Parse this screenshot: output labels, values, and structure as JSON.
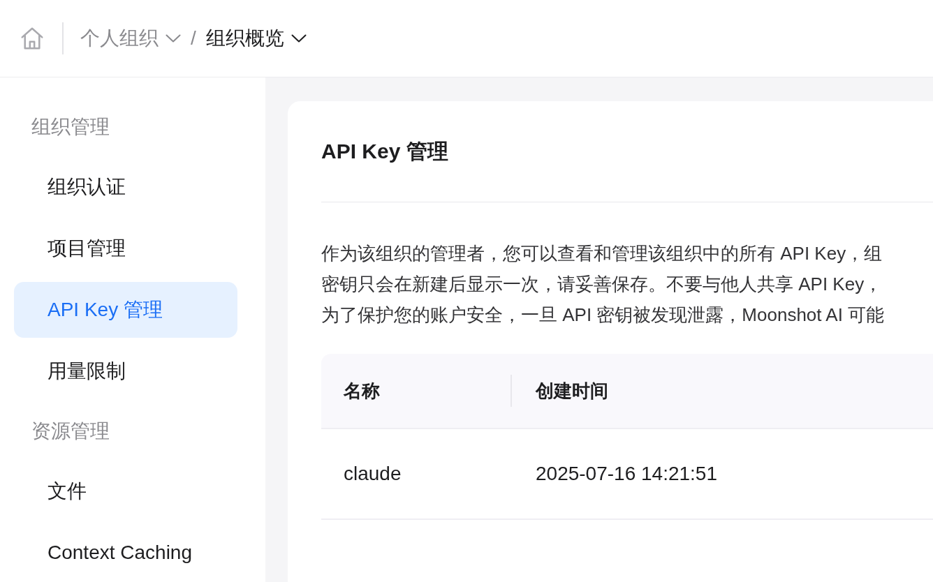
{
  "header": {
    "breadcrumbs": [
      {
        "label": "个人组织",
        "current": false
      },
      {
        "label": "组织概览",
        "current": true
      }
    ],
    "separator": "/"
  },
  "sidebar": {
    "sections": [
      {
        "title": "组织管理",
        "items": [
          {
            "label": "组织认证",
            "selected": false
          },
          {
            "label": "项目管理",
            "selected": false
          },
          {
            "label": "API Key 管理",
            "selected": true
          },
          {
            "label": "用量限制",
            "selected": false
          }
        ]
      },
      {
        "title": "资源管理",
        "items": [
          {
            "label": "文件",
            "selected": false
          },
          {
            "label": "Context Caching",
            "selected": false
          }
        ]
      }
    ]
  },
  "main": {
    "title": "API Key 管理",
    "description": [
      "作为该组织的管理者，您可以查看和管理该组织中的所有 API Key，组",
      "密钥只会在新建后显示一次，请妥善保存。不要与他人共享 API Key，",
      "为了保护您的账户安全，一旦 API 密钥被发现泄露，Moonshot AI 可能"
    ],
    "table": {
      "columns": [
        "名称",
        "创建时间"
      ],
      "rows": [
        [
          "claude",
          "2025-07-16 14:21:51"
        ]
      ]
    }
  }
}
